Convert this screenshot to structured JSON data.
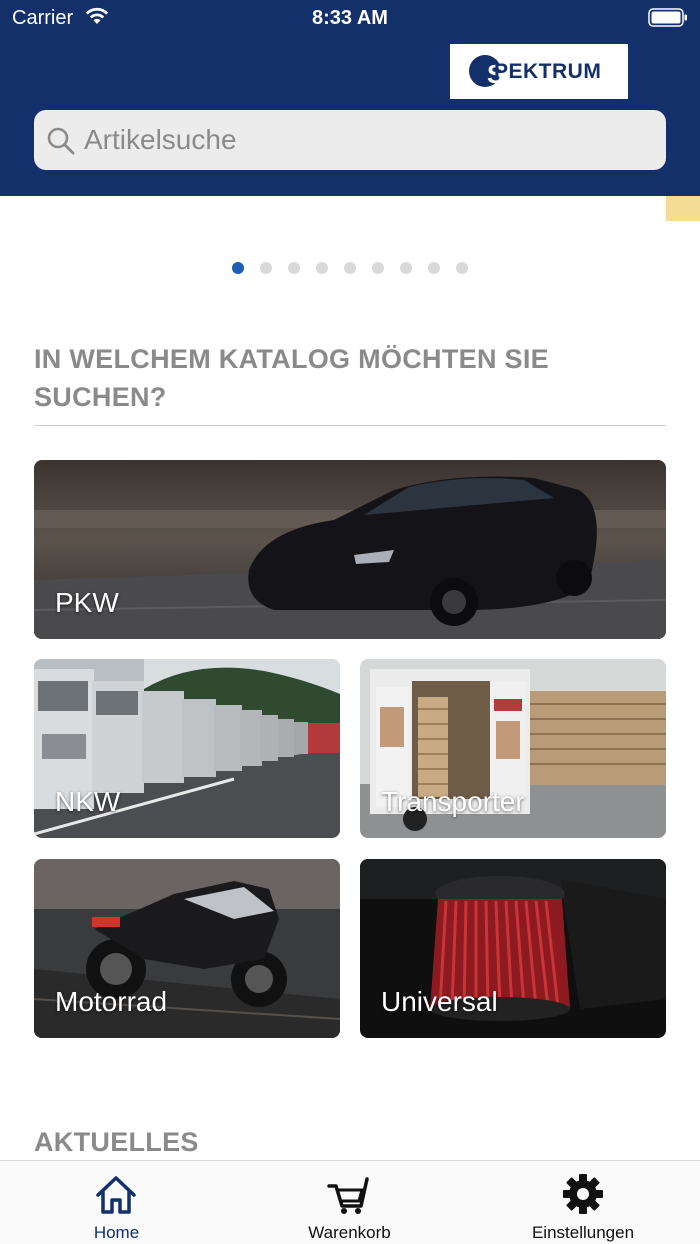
{
  "status_bar": {
    "carrier": "Carrier",
    "time": "8:33 AM"
  },
  "logo": {
    "text": "PEKTRUM",
    "brand": "SPEKTRUM"
  },
  "search": {
    "placeholder": "Artikelsuche"
  },
  "carousel": {
    "page_count": 9,
    "active_index": 0
  },
  "catalog": {
    "title": "IN WELCHEM KATALOG MÖCHTEN SIE SUCHEN?",
    "tiles": [
      {
        "label": "PKW"
      },
      {
        "label": "NKW"
      },
      {
        "label": "Transporter"
      },
      {
        "label": "Motorrad"
      },
      {
        "label": "Universal"
      }
    ]
  },
  "news": {
    "title": "AKTUELLES"
  },
  "tabbar": {
    "items": [
      {
        "label": "Home",
        "icon": "home-icon",
        "active": true
      },
      {
        "label": "Warenkorb",
        "icon": "cart-icon",
        "active": false
      },
      {
        "label": "Einstellungen",
        "icon": "gear-icon",
        "active": false
      }
    ]
  },
  "colors": {
    "header": "#13306a",
    "accent": "#1a5fb4",
    "banner_edge": "#f4dc94"
  }
}
